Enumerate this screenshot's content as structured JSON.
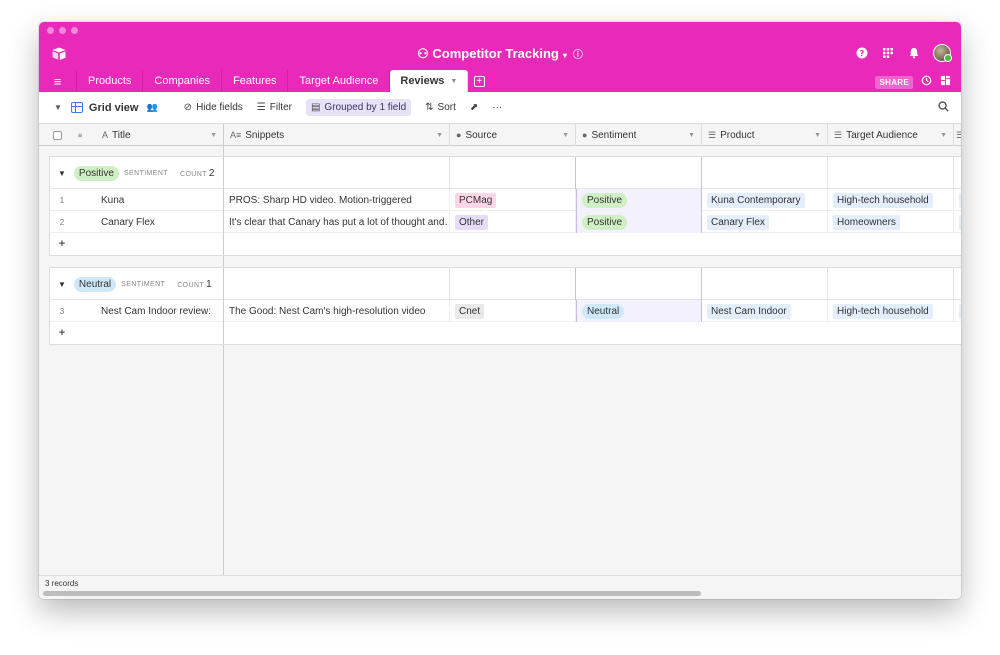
{
  "header": {
    "base_name": "Competitor Tracking",
    "base_caret": "▾",
    "info_glyph": "ⓘ",
    "share_label": "SHARE"
  },
  "icons": {
    "app_logo": "airtable-logo-icon",
    "help": "help-icon",
    "apps": "apps-icon",
    "bell": "notification-bell-icon",
    "history": "history-icon",
    "blocks": "blocks-icon",
    "search": "search-icon"
  },
  "tabs": [
    {
      "label": "Products"
    },
    {
      "label": "Companies"
    },
    {
      "label": "Features"
    },
    {
      "label": "Target Audience"
    },
    {
      "label": "Reviews",
      "active": true
    }
  ],
  "toolbar": {
    "view_name": "Grid view",
    "hide_fields": "Hide fields",
    "filter": "Filter",
    "grouped": "Grouped by 1 field",
    "sort": "Sort"
  },
  "columns": {
    "title": "Title",
    "snippets": "Snippets",
    "source": "Source",
    "sentiment": "Sentiment",
    "product": "Product",
    "target_audience": "Target Audience"
  },
  "groups": [
    {
      "value": "Positive",
      "field_label": "SENTIMENT",
      "count_label": "COUNT",
      "count": "2",
      "color": "#cfefc4",
      "rows": [
        {
          "num": "1",
          "title": "Kuna",
          "snippet": "PROS: Sharp HD video. Motion-triggered",
          "source": "PCMag",
          "source_color": "#ffd6e8",
          "sentiment": "Positive",
          "sentiment_color": "#cfefc4",
          "product": "Kuna Contemporary",
          "audience": "High-tech household"
        },
        {
          "num": "2",
          "title": "Canary Flex",
          "snippet": "It's clear that Canary has put a lot of thought and…",
          "source": "Other",
          "source_color": "#e6dcfa",
          "sentiment": "Positive",
          "sentiment_color": "#cfefc4",
          "product": "Canary Flex",
          "audience": "Homeowners"
        }
      ]
    },
    {
      "value": "Neutral",
      "field_label": "SENTIMENT",
      "count_label": "COUNT",
      "count": "1",
      "color": "#cfe8f9",
      "rows": [
        {
          "num": "3",
          "title": "Nest Cam Indoor review:",
          "snippet": "The Good: Nest Cam's high-resolution video",
          "source": "Cnet",
          "source_color": "#e9e9e9",
          "sentiment": "Neutral",
          "sentiment_color": "#cfe8f9",
          "product": "Nest Cam Indoor",
          "audience": "High-tech household"
        }
      ]
    }
  ],
  "footer": {
    "records": "3 records"
  }
}
